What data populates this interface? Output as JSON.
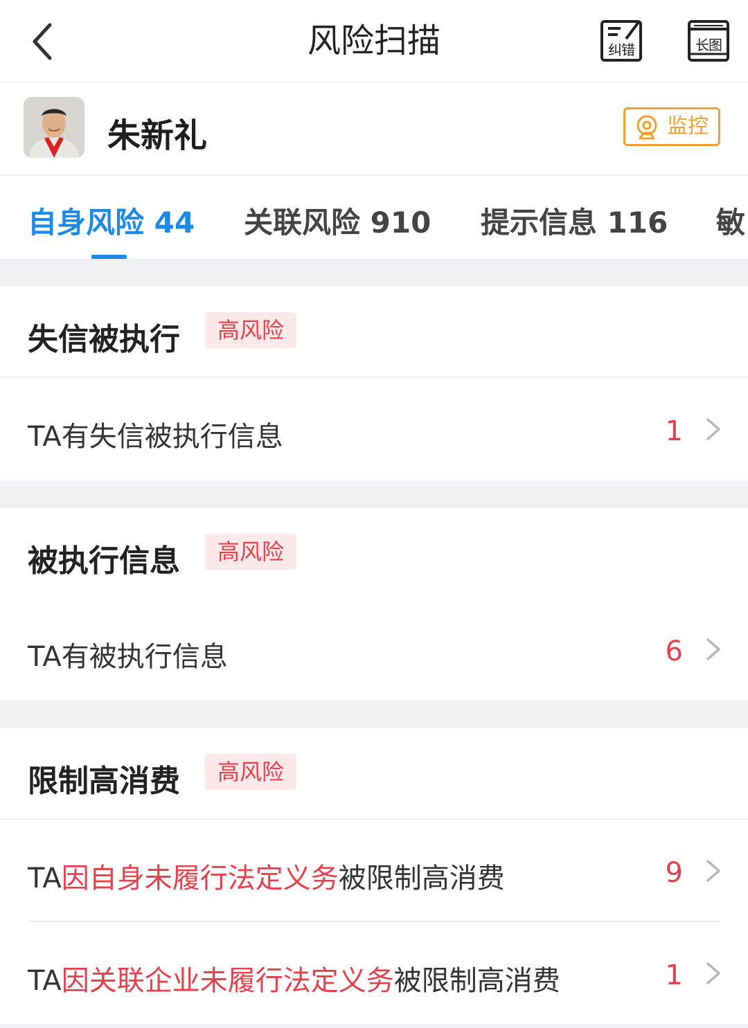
{
  "header": {
    "title": "风险扫描",
    "back_icon": "chevron-left-icon",
    "correct_label": "纠错",
    "long_image_label": "长图"
  },
  "profile": {
    "name": "朱新礼",
    "monitor_label": "监控",
    "colors": {
      "monitor": "#f0a030"
    }
  },
  "tabs": [
    {
      "label": "自身风险 44",
      "active": true
    },
    {
      "label": "关联风险 910",
      "active": false
    },
    {
      "label": "提示信息 116",
      "active": false
    },
    {
      "label": "敏",
      "active": false
    }
  ],
  "colors": {
    "accent": "#1c8be8",
    "risk": "#e8404a",
    "risk_bg": "#fde9e9"
  },
  "sections": [
    {
      "title": "失信被执行",
      "badge": "高风险",
      "rows": [
        {
          "text_pre": "TA有失信被执行信息",
          "text_hl": "",
          "text_post": "",
          "count": "1"
        }
      ]
    },
    {
      "title": "被执行信息",
      "badge": "高风险",
      "rows": [
        {
          "text_pre": "TA有被执行信息",
          "text_hl": "",
          "text_post": "",
          "count": "6"
        }
      ]
    },
    {
      "title": "限制高消费",
      "badge": "高风险",
      "rows": [
        {
          "text_pre": "TA",
          "text_hl": "因自身未履行法定义务",
          "text_post": "被限制高消费",
          "count": "9"
        },
        {
          "text_pre": "TA",
          "text_hl": "因关联企业未履行法定义务",
          "text_post": "被限制高消费",
          "count": "1"
        }
      ]
    }
  ]
}
